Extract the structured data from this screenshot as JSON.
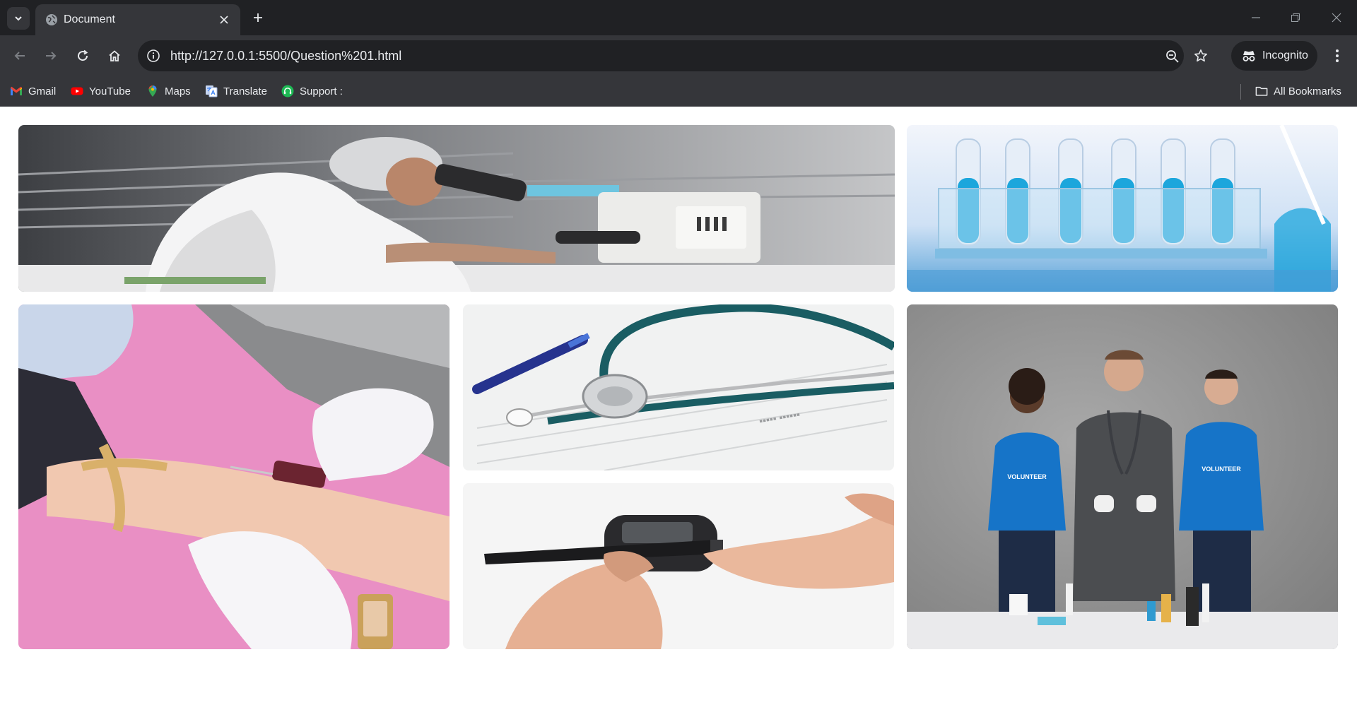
{
  "browser": {
    "tab": {
      "title": "Document"
    },
    "address": {
      "url": "http://127.0.0.1:5500/Question%201.html"
    },
    "profile": {
      "label": "Incognito"
    },
    "bookmarks": [
      {
        "label": "Gmail",
        "icon": "gmail-icon"
      },
      {
        "label": "YouTube",
        "icon": "youtube-icon"
      },
      {
        "label": "Maps",
        "icon": "maps-icon"
      },
      {
        "label": "Translate",
        "icon": "translate-icon"
      },
      {
        "label": "Support :",
        "icon": "support-icon"
      }
    ],
    "all_bookmarks": {
      "label": "All Bookmarks",
      "icon": "folder-icon"
    }
  },
  "gallery": {
    "images": [
      {
        "subject": "scientist looking through microscope"
      },
      {
        "subject": "test tubes with blue liquid in rack"
      },
      {
        "subject": "blood draw from arm with tourniquet"
      },
      {
        "subject": "stethoscope and pen on medical form"
      },
      {
        "subject": "glucose meter finger prick test"
      },
      {
        "subject": "volunteers and medic at table",
        "shirt_text": [
          "VOLUNTEER",
          "VOLUNTEER"
        ]
      }
    ]
  },
  "colors": {
    "chrome_dark": "#202124",
    "chrome_mid": "#35363a",
    "chrome_text": "#e8eaed",
    "page_bg": "#ffffff"
  }
}
